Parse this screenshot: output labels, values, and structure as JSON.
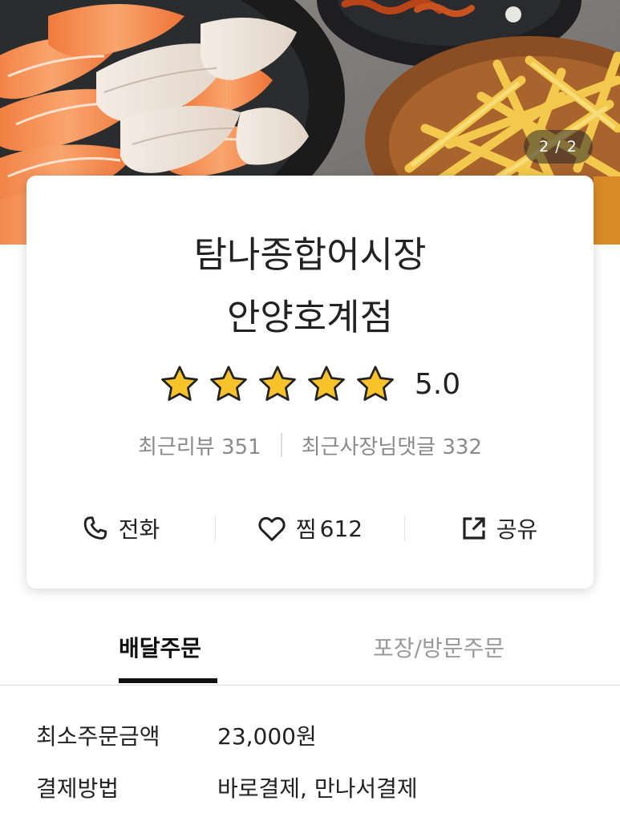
{
  "hero": {
    "page_indicator": "2 / 2"
  },
  "store": {
    "name_line1": "탐나종합어시장",
    "name_line2": "안양호계점",
    "rating": "5.0",
    "star_count": 5,
    "recent_reviews": "최근리뷰 351",
    "owner_replies": "최근사장님댓글 332"
  },
  "actions": {
    "call": {
      "label": "전화",
      "icon": "phone-icon"
    },
    "like": {
      "label": "찜",
      "count": "612",
      "icon": "heart-icon"
    },
    "share": {
      "label": "공유",
      "icon": "share-icon"
    }
  },
  "tabs": [
    {
      "label": "배달주문",
      "active": true
    },
    {
      "label": "포장/방문주문",
      "active": false
    }
  ],
  "info": {
    "min_order_label": "최소주문금액",
    "min_order_value": "23,000원",
    "payment_label": "결제방법",
    "payment_value": "바로결제, 만나서결제"
  },
  "colors": {
    "star": "#f7c22a",
    "text_primary": "#222222",
    "text_muted": "#8a8a8a",
    "tab_underline": "#111111"
  }
}
